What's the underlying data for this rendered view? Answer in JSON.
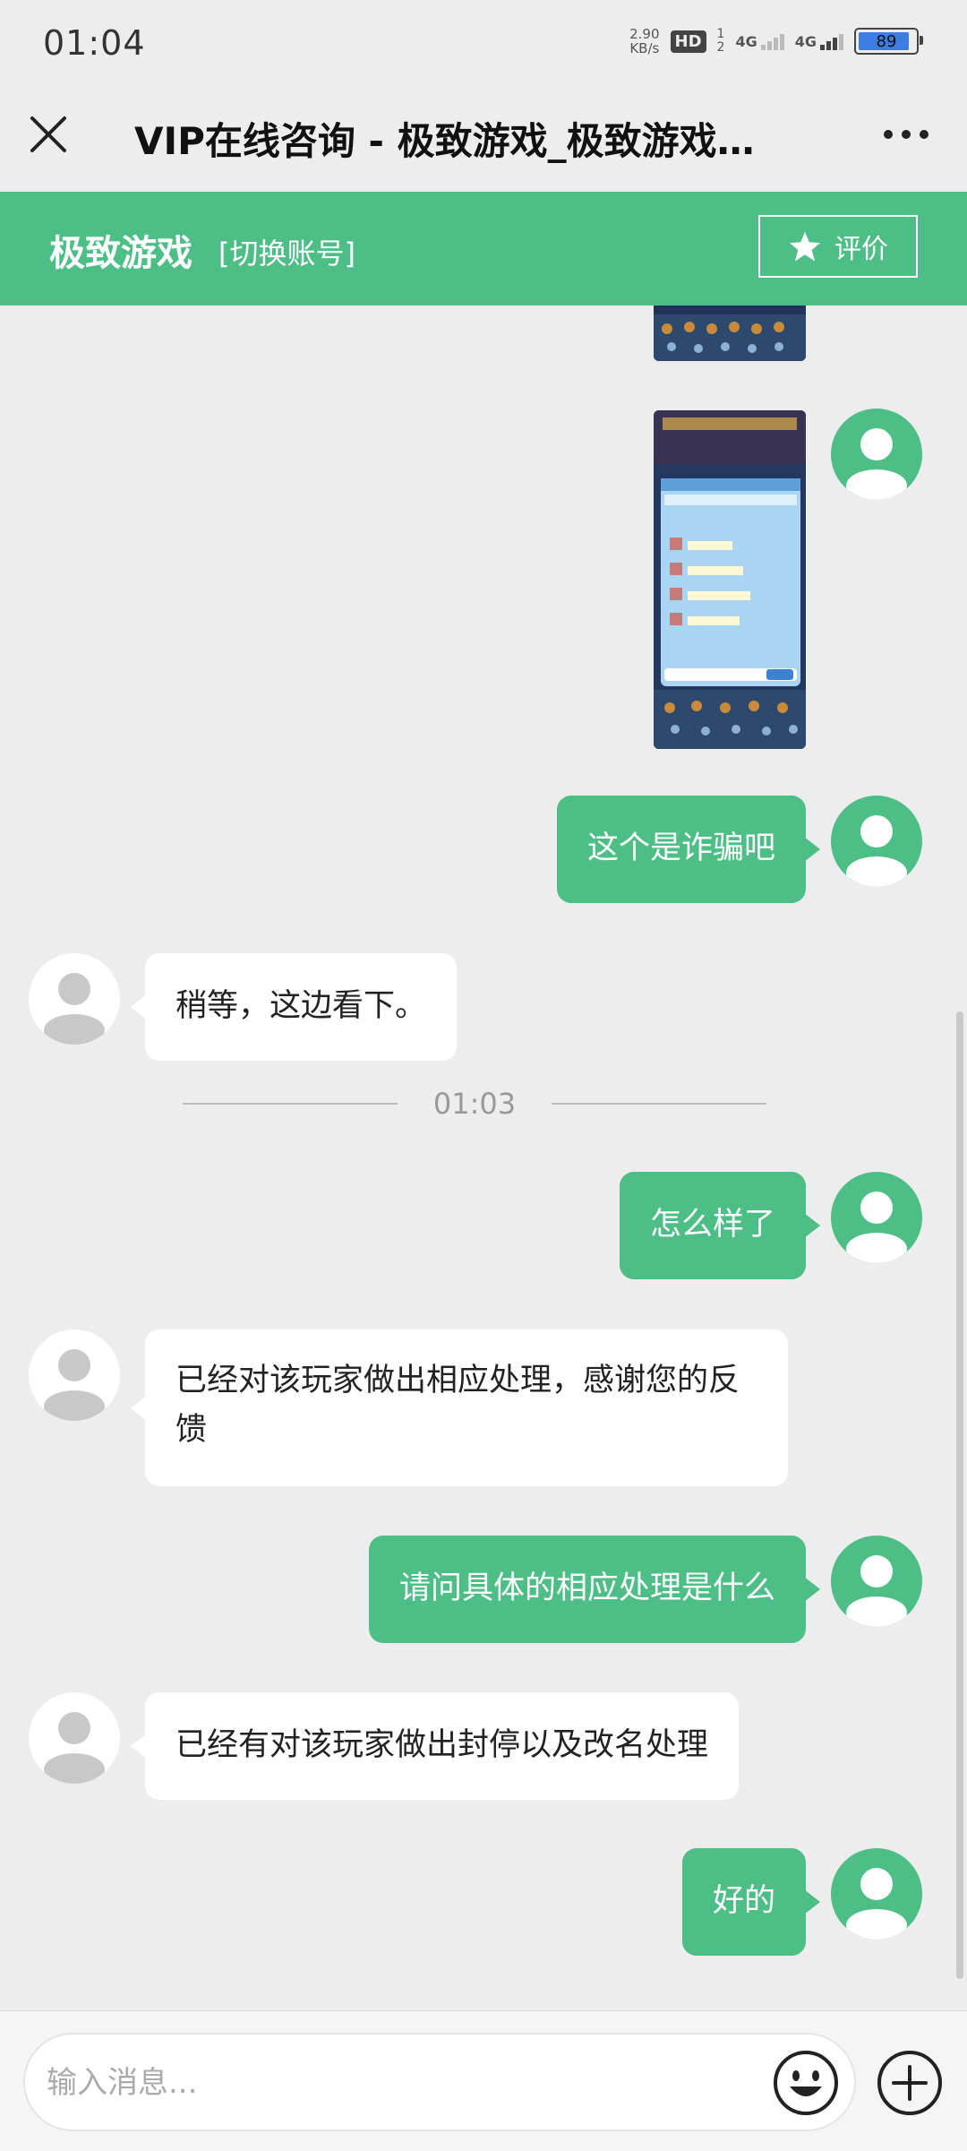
{
  "status_bar": {
    "time": "01:04",
    "net_speed_value": "2.90",
    "net_speed_unit": "KB/s",
    "hd_label": "HD",
    "sim_1": "1",
    "sim_2": "2",
    "network_1": "4G",
    "network_2": "4G",
    "battery_level": "89"
  },
  "title_bar": {
    "title": "VIP在线咨询 - 极致游戏_极致游戏…",
    "close_icon": "close-icon",
    "more_icon": "more-options-icon"
  },
  "header": {
    "brand": "极致游戏",
    "switch_account": "[切换账号]",
    "rate_label": "评价",
    "rate_icon": "star-icon",
    "color": "#4cbe86"
  },
  "messages": [
    {
      "from": "self",
      "type": "image",
      "description": "game screenshot (partial)"
    },
    {
      "from": "self",
      "type": "image",
      "description": "game chat screenshot"
    },
    {
      "from": "self",
      "type": "text",
      "text": "这个是诈骗吧"
    },
    {
      "from": "agent",
      "type": "text",
      "text": "稍等，这边看下。"
    },
    {
      "type": "timestamp",
      "text": "01:03"
    },
    {
      "from": "self",
      "type": "text",
      "text": "怎么样了"
    },
    {
      "from": "agent",
      "type": "text",
      "text": "已经对该玩家做出相应处理，感谢您的反馈"
    },
    {
      "from": "self",
      "type": "text",
      "text": "请问具体的相应处理是什么"
    },
    {
      "from": "agent",
      "type": "text",
      "text": "已经有对该玩家做出封停以及改名处理"
    },
    {
      "from": "self",
      "type": "text",
      "text": "好的"
    }
  ],
  "input": {
    "placeholder": "输入消息...",
    "value": "",
    "emoji_icon": "emoji-icon",
    "plus_icon": "plus-icon"
  }
}
